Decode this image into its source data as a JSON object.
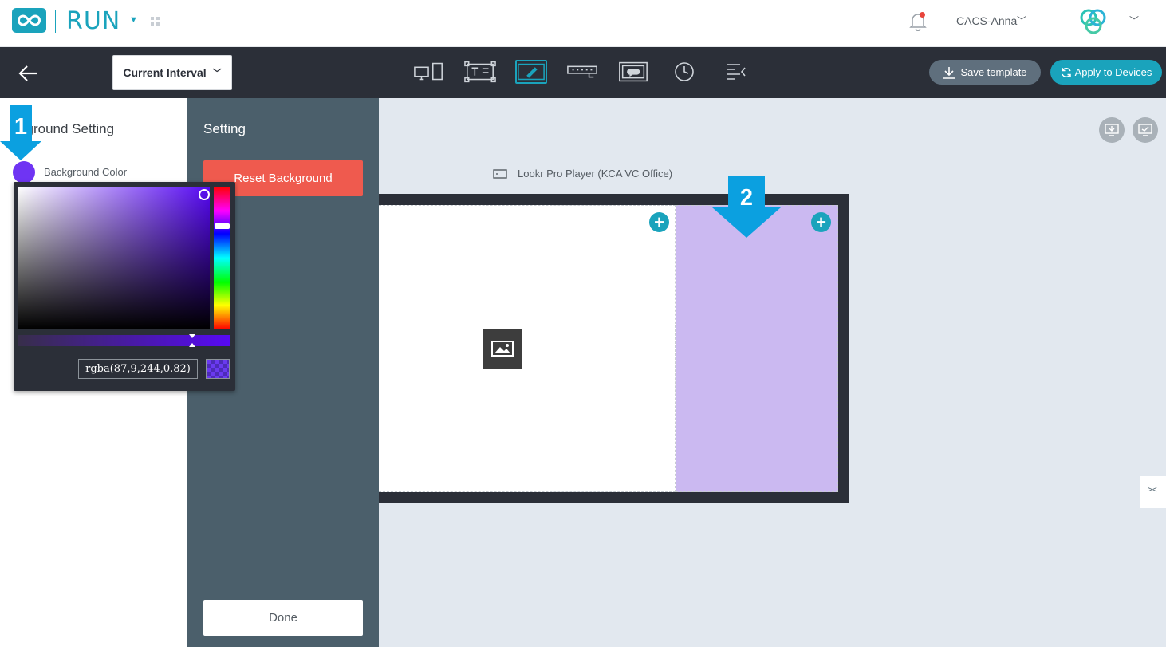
{
  "header": {
    "brand": "RUN",
    "user_name": "CACS-Anna"
  },
  "toolbar": {
    "interval_label": "Current Interval",
    "save_template_label": "Save template",
    "apply_devices_label": "Apply to Devices"
  },
  "left_panel": {
    "title": "kground Setting",
    "background_color_label": "Background Color"
  },
  "color_picker": {
    "value": "rgba(87,9,244,0.82)"
  },
  "setting_panel": {
    "title": "Setting",
    "reset_label": "Reset Background",
    "done_label": "Done"
  },
  "canvas": {
    "device_name": "Lookr Pro Player (KCA VC Office)"
  },
  "steps": {
    "first": "1",
    "second": "2"
  },
  "colors": {
    "accent": "#1aa3bc",
    "toolbar_bg": "#2b2f38",
    "setting_bg": "#4b5f6b",
    "reset_red": "#ef5a4e",
    "zone_purple": "#cbb9f1",
    "step_blue": "#0ba0e0"
  }
}
